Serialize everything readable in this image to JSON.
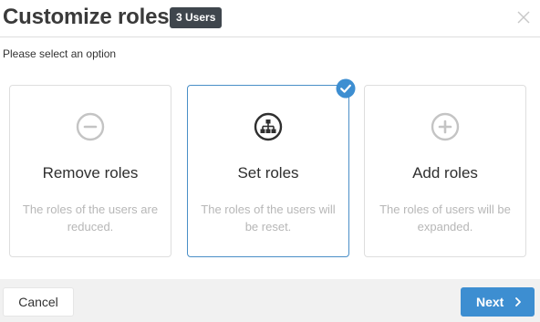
{
  "header": {
    "title": "Customize roles",
    "badge": "3 Users",
    "close_icon": "close-icon"
  },
  "subtitle": "Please select an option",
  "options": [
    {
      "title": "Remove roles",
      "description": "The roles of the users are reduced.",
      "icon": "minus-circle-icon",
      "selected": false
    },
    {
      "title": "Set roles",
      "description": "The roles of the users will be reset.",
      "icon": "hierarchy-icon",
      "selected": true
    },
    {
      "title": "Add roles",
      "description": "The roles of users will be expanded.",
      "icon": "plus-circle-icon",
      "selected": false
    }
  ],
  "footer": {
    "cancel_label": "Cancel",
    "next_label": "Next",
    "next_icon": "chevron-right-icon"
  },
  "colors": {
    "accent": "#3d8ed1",
    "selected_border": "#4a8fc7",
    "badge_bg": "#3f464d",
    "footer_bg": "#f1f1f1"
  }
}
